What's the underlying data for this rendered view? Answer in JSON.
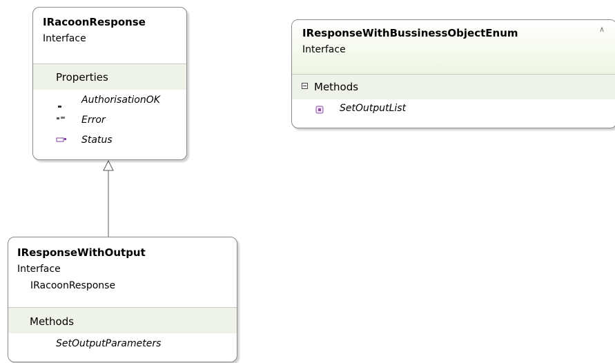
{
  "shapes": {
    "racoon": {
      "title": "IRacoonResponse",
      "kind": "Interface",
      "section_label": "Properties",
      "members": [
        "AuthorisationOK",
        "Error",
        "Status"
      ]
    },
    "output": {
      "title": "IResponseWithOutput",
      "kind": "Interface",
      "base": "IRacoonResponse",
      "section_label": "Methods",
      "members": [
        "SetOutputParameters"
      ]
    },
    "enum": {
      "title": "IResponseWithBussinessObjectEnum",
      "kind": "Interface",
      "section_label": "Methods",
      "members": [
        "SetOutputList"
      ]
    }
  },
  "icons": {
    "property": "property-icon",
    "method": "method-icon",
    "collapse": "collapse-icon",
    "expand": "double-chevron-icon"
  },
  "colors": {
    "header_gradient_top": "#ffffff",
    "header_gradient_bottom": "#eef5e2",
    "section_band": "#eef2e8",
    "border": "#8a8a8a"
  }
}
